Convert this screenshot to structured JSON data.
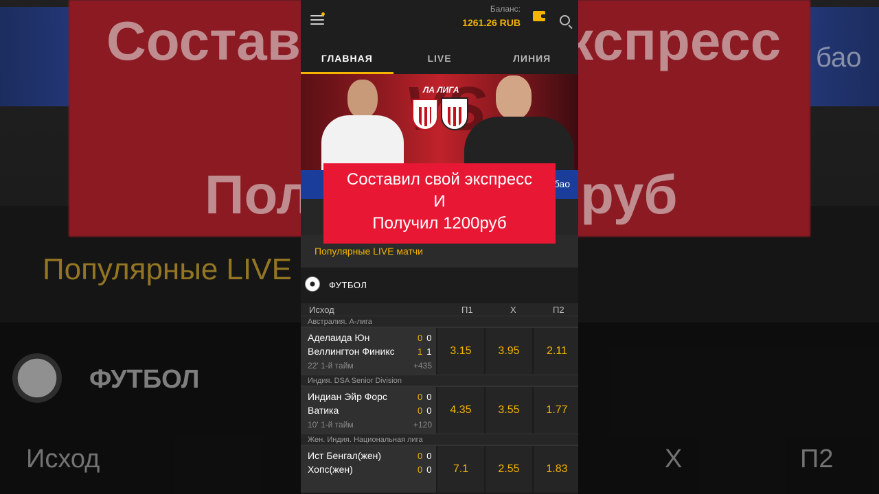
{
  "background": {
    "big_top": "Состав",
    "big_top_right": "экспресс",
    "big_mid_left": "Пол",
    "big_mid_right": "руб",
    "bao": "бао",
    "popular": "Популярные LIVE",
    "futbol": "ФУТБОЛ",
    "ishod": "Исход",
    "x": "X",
    "p2": "П2"
  },
  "header": {
    "balance_label": "Баланс:",
    "balance_value": "1261.26 RUB"
  },
  "tabs": [
    {
      "label": "ГЛАВНАЯ",
      "active": true
    },
    {
      "label": "LIVE",
      "active": false
    },
    {
      "label": "ЛИНИЯ",
      "active": false
    }
  ],
  "banner": {
    "league": "ЛА ЛИГА",
    "vs": "VS",
    "strip_text": "бао"
  },
  "overlay": {
    "line1": "Составил свой экспресс",
    "line2": "И",
    "line3": "Получил 1200руб"
  },
  "popular_label": "Популярные LIVE матчи",
  "section": {
    "title": "ФУТБОЛ",
    "icon": "soccer-ball-icon"
  },
  "columns": {
    "outcome": "Исход",
    "p1": "П1",
    "x": "X",
    "p2": "П2"
  },
  "matches": [
    {
      "league": "Австралия. А-лига",
      "team1": "Аделаида Юн",
      "score1a": "0",
      "score1b": "0",
      "team2": "Веллингтон Финикс",
      "score2a": "1",
      "score2b": "1",
      "time": "22' 1-й тайм",
      "more": "+435",
      "odds": [
        "3.15",
        "3.95",
        "2.11"
      ]
    },
    {
      "league": "Индия. DSA Senior Division",
      "team1": "Индиан Эйр Форс",
      "score1a": "0",
      "score1b": "0",
      "team2": "Ватика",
      "score2a": "0",
      "score2b": "0",
      "time": "10' 1-й тайм",
      "more": "+120",
      "odds": [
        "4.35",
        "3.55",
        "1.77"
      ]
    },
    {
      "league": "Жен. Индия. Национальная лига",
      "team1": "Ист Бенгал(жен)",
      "score1a": "0",
      "score1b": "0",
      "team2": "Хопс(жен)",
      "score2a": "0",
      "score2b": "0",
      "time": "",
      "more": "",
      "odds": [
        "7.1",
        "2.55",
        "1.83"
      ]
    }
  ],
  "colors": {
    "accent": "#f4b400",
    "overlay_red": "#e81834",
    "banner_blue": "#1a3c9a"
  }
}
